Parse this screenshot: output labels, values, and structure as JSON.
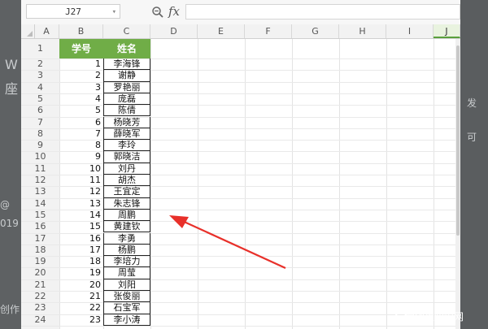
{
  "namebox": {
    "cell_ref": "J27"
  },
  "formula": {
    "fx_label": "fx",
    "value": ""
  },
  "columns": [
    "A",
    "B",
    "C",
    "D",
    "E",
    "F",
    "G",
    "H",
    "I",
    "J"
  ],
  "selected_column": "J",
  "rows": [
    "1",
    "2",
    "3",
    "4",
    "5",
    "6",
    "7",
    "8",
    "9",
    "10",
    "11",
    "12",
    "13",
    "14",
    "15",
    "16",
    "17",
    "18",
    "19",
    "20",
    "21",
    "22",
    "23",
    "24"
  ],
  "table": {
    "headers": {
      "b": "学号",
      "c": "姓名"
    },
    "records": [
      {
        "id": "1",
        "name": "李海锋"
      },
      {
        "id": "2",
        "name": "谢静"
      },
      {
        "id": "3",
        "name": "罗艳丽"
      },
      {
        "id": "4",
        "name": "庞磊"
      },
      {
        "id": "5",
        "name": "陈倩"
      },
      {
        "id": "6",
        "name": "杨晓芳"
      },
      {
        "id": "7",
        "name": "薛晓军"
      },
      {
        "id": "8",
        "name": "李玲"
      },
      {
        "id": "9",
        "name": "郭晓洁"
      },
      {
        "id": "10",
        "name": "刘丹"
      },
      {
        "id": "11",
        "name": "胡杰"
      },
      {
        "id": "12",
        "name": "王宜定"
      },
      {
        "id": "13",
        "name": "朱志锋"
      },
      {
        "id": "14",
        "name": "周鹏"
      },
      {
        "id": "15",
        "name": "黄建钦"
      },
      {
        "id": "16",
        "name": "李勇"
      },
      {
        "id": "17",
        "name": "杨鹏"
      },
      {
        "id": "18",
        "name": "李培力"
      },
      {
        "id": "19",
        "name": "周莹"
      },
      {
        "id": "20",
        "name": "刘阳"
      },
      {
        "id": "21",
        "name": "张俊丽"
      },
      {
        "id": "22",
        "name": "石宝军"
      },
      {
        "id": "23",
        "name": "李小涛"
      }
    ]
  },
  "background_text": {
    "left_w": "W",
    "left_zuo": "座",
    "left_at": "@",
    "left_019": "019",
    "left_zuozhe": "创作",
    "right_fa": "发",
    "right_ke": "可"
  },
  "annotation": {
    "arrow_color": "#e8302a"
  },
  "watermark": {
    "text": "爱创根知识网"
  }
}
